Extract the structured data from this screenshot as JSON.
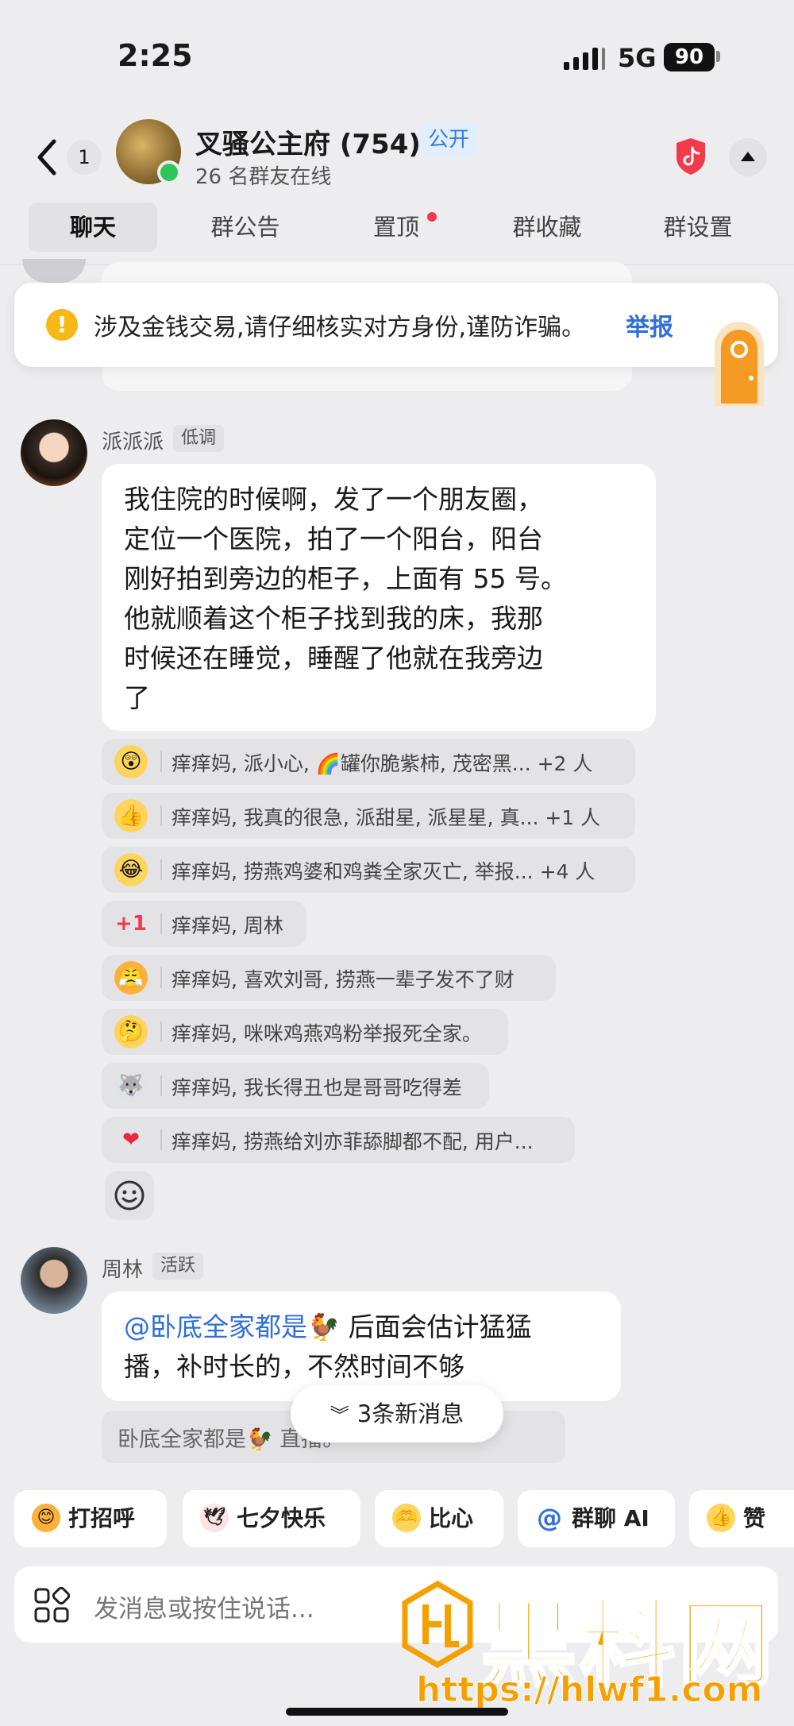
{
  "status_bar": {
    "time": "2:25",
    "network": "5G",
    "battery": "90"
  },
  "header": {
    "unread_count": "1",
    "group_name": "叉骚公主府 (754)",
    "public_badge": "公开",
    "online_count": "26 名群友在线"
  },
  "tabs": [
    {
      "label": "聊天",
      "active": true
    },
    {
      "label": "群公告"
    },
    {
      "label": "置顶",
      "has_dot": true
    },
    {
      "label": "群收藏"
    },
    {
      "label": "群设置"
    }
  ],
  "warning": {
    "text": "涉及金钱交易,请仔细核实对方身份,谨防诈骗。",
    "link": "举报"
  },
  "messages": [
    {
      "sender": "派派派",
      "tag": "低调",
      "lines": [
        "我住院的时候啊，发了一个朋友圈，",
        "定位一个医院，拍了一个阳台，阳台",
        "刚好拍到旁边的柜子，上面有 55 号。",
        "他就顺着这个柜子找到我的床，我那",
        "时候还在睡觉，睡醒了他就在我旁边",
        "了"
      ],
      "reactions": [
        {
          "icon": "shocked-face-emoji",
          "glyph": "😲",
          "text": "痒痒妈, 派小心, 🌈罐你脆紫柿, 茂密黑... +2 人"
        },
        {
          "icon": "thumbs-up-emoji",
          "glyph": "👍",
          "text": "痒痒妈, 我真的很急, 派甜星, 派星星, 真... +1 人"
        },
        {
          "icon": "laughing-tears-emoji",
          "glyph": "😂",
          "text": "痒痒妈, 捞燕鸡婆和鸡粪全家灭亡, 举报... +4 人"
        },
        {
          "icon": "plus-one-emoji",
          "glyph": "+1",
          "text": "痒痒妈, 周林"
        },
        {
          "icon": "angry-face-emoji",
          "glyph": "😤",
          "text": "痒痒妈, 喜欢刘哥, 捞燕一辈子发不了财"
        },
        {
          "icon": "thinking-face-emoji",
          "glyph": "🤔",
          "text": "痒痒妈, 咪咪鸡燕鸡粉举报死全家。"
        },
        {
          "icon": "husky-dog-emoji",
          "glyph": "🐺",
          "text": "痒痒妈, 我长得丑也是哥哥吃得差"
        },
        {
          "icon": "red-heart-emoji",
          "glyph": "❤",
          "text": "痒痒妈, 捞燕给刘亦菲舔脚都不配, 用户..."
        }
      ]
    },
    {
      "sender": "周林",
      "tag": "活跃",
      "mention": "@卧底全家都是🐓",
      "line1_rest": " 后面会估计猛猛",
      "line2": "播，补时长的，不然时间不够",
      "reply_quote": "卧底全家都是🐓                              直播。"
    }
  ],
  "new_messages_pill": "3条新消息",
  "quick_actions": [
    {
      "label": "打招呼",
      "icon": "wave-emoji",
      "glyph": "😊"
    },
    {
      "label": "七夕快乐",
      "icon": "dove-emoji",
      "glyph": "🕊"
    },
    {
      "label": "比心",
      "icon": "heart-hands-emoji",
      "glyph": "🫶"
    },
    {
      "label": "群聊 AI",
      "icon": "at-icon",
      "glyph": "@"
    },
    {
      "label": "赞",
      "icon": "thumbs-up-emoji",
      "glyph": "👍"
    }
  ],
  "input": {
    "placeholder": "发消息或按住说话..."
  },
  "watermark": {
    "text": "黑料网",
    "url": "https://hlwf1.com"
  },
  "colors": {
    "accent_blue": "#2f6fd8",
    "online_green": "#2ec55a",
    "warning_yellow": "#f6b817",
    "watermark_orange": "#f5a000"
  }
}
